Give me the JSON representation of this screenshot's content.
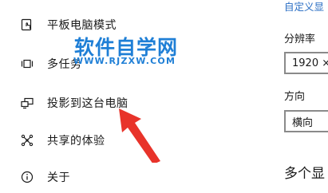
{
  "nav": {
    "items": [
      {
        "label": "平板电脑模式",
        "icon": "tablet-mode-icon"
      },
      {
        "label": "多任务",
        "icon": "multitasking-icon"
      },
      {
        "label": "投影到这台电脑",
        "icon": "project-to-pc-icon"
      },
      {
        "label": "共享的体验",
        "icon": "shared-experiences-icon"
      },
      {
        "label": "关于",
        "icon": "info-icon"
      }
    ]
  },
  "watermark": {
    "title": "软件自学网",
    "url": "WWW.RJZXW.COM",
    "color": "#1f7fd6"
  },
  "arrow": {
    "color": "#e8332a"
  },
  "right_panel": {
    "link": "自定义显",
    "resolution_label": "分辨率",
    "resolution_value": "1920 ×",
    "orientation_label": "方向",
    "orientation_value": "横向",
    "section_heading": "多个显"
  }
}
